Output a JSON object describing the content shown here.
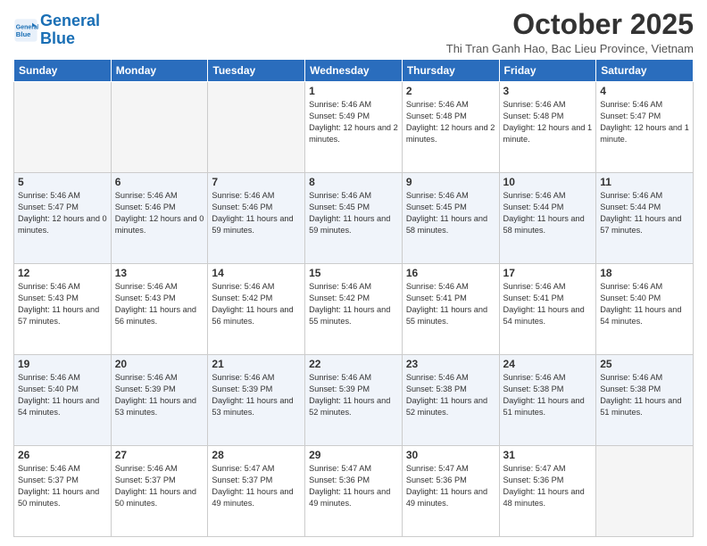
{
  "header": {
    "logo_line1": "General",
    "logo_line2": "Blue",
    "title": "October 2025",
    "subtitle": "Thi Tran Ganh Hao, Bac Lieu Province, Vietnam"
  },
  "days_of_week": [
    "Sunday",
    "Monday",
    "Tuesday",
    "Wednesday",
    "Thursday",
    "Friday",
    "Saturday"
  ],
  "weeks": [
    [
      {
        "day": "",
        "info": ""
      },
      {
        "day": "",
        "info": ""
      },
      {
        "day": "",
        "info": ""
      },
      {
        "day": "1",
        "info": "Sunrise: 5:46 AM\nSunset: 5:49 PM\nDaylight: 12 hours and 2 minutes."
      },
      {
        "day": "2",
        "info": "Sunrise: 5:46 AM\nSunset: 5:48 PM\nDaylight: 12 hours and 2 minutes."
      },
      {
        "day": "3",
        "info": "Sunrise: 5:46 AM\nSunset: 5:48 PM\nDaylight: 12 hours and 1 minute."
      },
      {
        "day": "4",
        "info": "Sunrise: 5:46 AM\nSunset: 5:47 PM\nDaylight: 12 hours and 1 minute."
      }
    ],
    [
      {
        "day": "5",
        "info": "Sunrise: 5:46 AM\nSunset: 5:47 PM\nDaylight: 12 hours and 0 minutes."
      },
      {
        "day": "6",
        "info": "Sunrise: 5:46 AM\nSunset: 5:46 PM\nDaylight: 12 hours and 0 minutes."
      },
      {
        "day": "7",
        "info": "Sunrise: 5:46 AM\nSunset: 5:46 PM\nDaylight: 11 hours and 59 minutes."
      },
      {
        "day": "8",
        "info": "Sunrise: 5:46 AM\nSunset: 5:45 PM\nDaylight: 11 hours and 59 minutes."
      },
      {
        "day": "9",
        "info": "Sunrise: 5:46 AM\nSunset: 5:45 PM\nDaylight: 11 hours and 58 minutes."
      },
      {
        "day": "10",
        "info": "Sunrise: 5:46 AM\nSunset: 5:44 PM\nDaylight: 11 hours and 58 minutes."
      },
      {
        "day": "11",
        "info": "Sunrise: 5:46 AM\nSunset: 5:44 PM\nDaylight: 11 hours and 57 minutes."
      }
    ],
    [
      {
        "day": "12",
        "info": "Sunrise: 5:46 AM\nSunset: 5:43 PM\nDaylight: 11 hours and 57 minutes."
      },
      {
        "day": "13",
        "info": "Sunrise: 5:46 AM\nSunset: 5:43 PM\nDaylight: 11 hours and 56 minutes."
      },
      {
        "day": "14",
        "info": "Sunrise: 5:46 AM\nSunset: 5:42 PM\nDaylight: 11 hours and 56 minutes."
      },
      {
        "day": "15",
        "info": "Sunrise: 5:46 AM\nSunset: 5:42 PM\nDaylight: 11 hours and 55 minutes."
      },
      {
        "day": "16",
        "info": "Sunrise: 5:46 AM\nSunset: 5:41 PM\nDaylight: 11 hours and 55 minutes."
      },
      {
        "day": "17",
        "info": "Sunrise: 5:46 AM\nSunset: 5:41 PM\nDaylight: 11 hours and 54 minutes."
      },
      {
        "day": "18",
        "info": "Sunrise: 5:46 AM\nSunset: 5:40 PM\nDaylight: 11 hours and 54 minutes."
      }
    ],
    [
      {
        "day": "19",
        "info": "Sunrise: 5:46 AM\nSunset: 5:40 PM\nDaylight: 11 hours and 54 minutes."
      },
      {
        "day": "20",
        "info": "Sunrise: 5:46 AM\nSunset: 5:39 PM\nDaylight: 11 hours and 53 minutes."
      },
      {
        "day": "21",
        "info": "Sunrise: 5:46 AM\nSunset: 5:39 PM\nDaylight: 11 hours and 53 minutes."
      },
      {
        "day": "22",
        "info": "Sunrise: 5:46 AM\nSunset: 5:39 PM\nDaylight: 11 hours and 52 minutes."
      },
      {
        "day": "23",
        "info": "Sunrise: 5:46 AM\nSunset: 5:38 PM\nDaylight: 11 hours and 52 minutes."
      },
      {
        "day": "24",
        "info": "Sunrise: 5:46 AM\nSunset: 5:38 PM\nDaylight: 11 hours and 51 minutes."
      },
      {
        "day": "25",
        "info": "Sunrise: 5:46 AM\nSunset: 5:38 PM\nDaylight: 11 hours and 51 minutes."
      }
    ],
    [
      {
        "day": "26",
        "info": "Sunrise: 5:46 AM\nSunset: 5:37 PM\nDaylight: 11 hours and 50 minutes."
      },
      {
        "day": "27",
        "info": "Sunrise: 5:46 AM\nSunset: 5:37 PM\nDaylight: 11 hours and 50 minutes."
      },
      {
        "day": "28",
        "info": "Sunrise: 5:47 AM\nSunset: 5:37 PM\nDaylight: 11 hours and 49 minutes."
      },
      {
        "day": "29",
        "info": "Sunrise: 5:47 AM\nSunset: 5:36 PM\nDaylight: 11 hours and 49 minutes."
      },
      {
        "day": "30",
        "info": "Sunrise: 5:47 AM\nSunset: 5:36 PM\nDaylight: 11 hours and 49 minutes."
      },
      {
        "day": "31",
        "info": "Sunrise: 5:47 AM\nSunset: 5:36 PM\nDaylight: 11 hours and 48 minutes."
      },
      {
        "day": "",
        "info": ""
      }
    ]
  ]
}
